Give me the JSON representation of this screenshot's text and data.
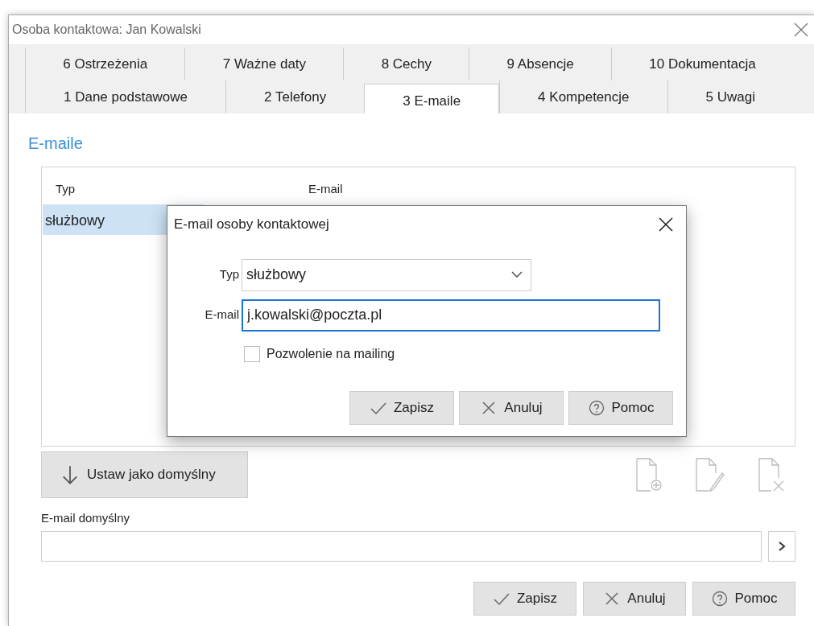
{
  "window": {
    "title": "Osoba kontaktowa: Jan Kowalski"
  },
  "tab_rows": [
    [
      {
        "label": "6 Ostrzeżenia",
        "selected": false
      },
      {
        "label": "7 Ważne daty",
        "selected": false
      },
      {
        "label": "8 Cechy",
        "selected": false
      },
      {
        "label": "9 Absencje",
        "selected": false
      },
      {
        "label": "10 Dokumentacja",
        "selected": false
      }
    ],
    [
      {
        "label": "1 Dane podstawowe",
        "selected": false
      },
      {
        "label": "2 Telefony",
        "selected": false
      },
      {
        "label": "3 E-maile",
        "selected": true
      },
      {
        "label": "4 Kompetencje",
        "selected": false
      },
      {
        "label": "5 Uwagi",
        "selected": false
      }
    ]
  ],
  "section_title": "E-maile",
  "table": {
    "columns": [
      "Typ",
      "E-mail"
    ],
    "rows": [
      {
        "cells": [
          "służbowy"
        ],
        "selected": true
      }
    ]
  },
  "dialog": {
    "title": "E-mail osoby kontaktowej",
    "fields": [
      {
        "kind": "select",
        "label": "Typ",
        "value": "służbowy",
        "focused": false
      },
      {
        "kind": "text",
        "label": "E-mail",
        "value": "j.kowalski@poczta.pl",
        "focused": true
      }
    ],
    "checkbox": {
      "label": "Pozwolenie na mailing",
      "checked": false
    },
    "buttons": [
      {
        "kind": "save",
        "label": "Zapisz"
      },
      {
        "kind": "cancel",
        "label": "Anuluj"
      },
      {
        "kind": "help",
        "label": "Pomoc"
      }
    ]
  },
  "set_default_button": {
    "label": "Ustaw jako domyślny"
  },
  "default_email": {
    "label": "E-mail domyślny"
  },
  "buttons": [
    {
      "kind": "save",
      "label": "Zapisz"
    },
    {
      "kind": "cancel",
      "label": "Anuluj"
    },
    {
      "kind": "help",
      "label": "Pomoc"
    }
  ]
}
